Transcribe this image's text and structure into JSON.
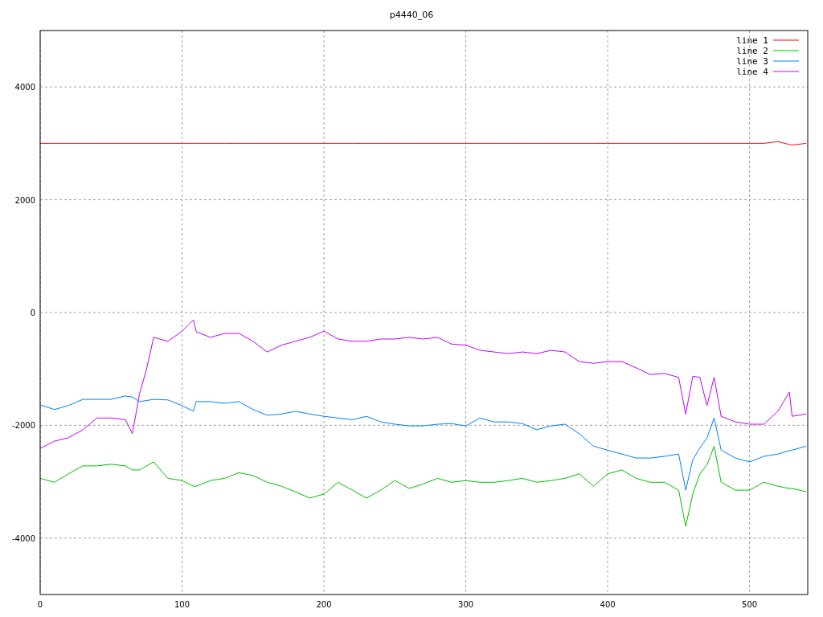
{
  "chart_data": {
    "type": "line",
    "title": "p4440_06",
    "x": [
      0,
      10,
      20,
      30,
      40,
      50,
      60,
      65,
      70,
      75,
      80,
      90,
      100,
      108,
      110,
      120,
      130,
      140,
      150,
      160,
      170,
      180,
      190,
      200,
      210,
      220,
      230,
      240,
      250,
      260,
      270,
      280,
      290,
      300,
      310,
      320,
      330,
      340,
      350,
      360,
      370,
      380,
      390,
      400,
      410,
      420,
      430,
      440,
      450,
      455,
      460,
      465,
      470,
      475,
      480,
      490,
      500,
      510,
      520,
      528,
      530,
      540
    ],
    "series": [
      {
        "name": "line 1",
        "color": "#ff0000",
        "values": [
          3000,
          3000,
          3000,
          3000,
          3000,
          3000,
          3000,
          3000,
          3000,
          3000,
          3000,
          3000,
          3000,
          3000,
          3000,
          3000,
          3000,
          3000,
          3000,
          3000,
          3000,
          3000,
          3000,
          3000,
          3000,
          3000,
          3000,
          3000,
          3000,
          3000,
          3000,
          3000,
          3000,
          3000,
          3000,
          3000,
          3000,
          3000,
          3000,
          3000,
          3000,
          3000,
          3000,
          3000,
          3000,
          3000,
          3000,
          3000,
          3000,
          3000,
          3000,
          3000,
          3000,
          3000,
          3000,
          3000,
          3000,
          3000,
          3030,
          2980,
          2970,
          3000
        ]
      },
      {
        "name": "line 2",
        "color": "#00c000",
        "values": [
          -2940,
          -3010,
          -2860,
          -2720,
          -2720,
          -2690,
          -2720,
          -2790,
          -2790,
          -2720,
          -2650,
          -2940,
          -2980,
          -3080,
          -3080,
          -2980,
          -2940,
          -2840,
          -2890,
          -3010,
          -3080,
          -3180,
          -3290,
          -3220,
          -3010,
          -3150,
          -3290,
          -3150,
          -2980,
          -3120,
          -3040,
          -2940,
          -3010,
          -2980,
          -3010,
          -3010,
          -2980,
          -2940,
          -3010,
          -2980,
          -2940,
          -2860,
          -3080,
          -2860,
          -2790,
          -2940,
          -3010,
          -3010,
          -3150,
          -3790,
          -3220,
          -2860,
          -2700,
          -2370,
          -3010,
          -3150,
          -3150,
          -3010,
          -3080,
          -3120,
          -3120,
          -3180
        ]
      },
      {
        "name": "line 3",
        "color": "#0080ff",
        "values": [
          -1640,
          -1720,
          -1650,
          -1540,
          -1540,
          -1540,
          -1480,
          -1500,
          -1580,
          -1560,
          -1540,
          -1550,
          -1650,
          -1750,
          -1580,
          -1580,
          -1610,
          -1580,
          -1720,
          -1820,
          -1800,
          -1750,
          -1800,
          -1840,
          -1870,
          -1900,
          -1840,
          -1940,
          -1980,
          -2010,
          -2010,
          -1980,
          -1970,
          -2010,
          -1870,
          -1940,
          -1940,
          -1970,
          -2080,
          -2010,
          -1980,
          -2150,
          -2370,
          -2440,
          -2510,
          -2580,
          -2580,
          -2550,
          -2510,
          -3150,
          -2610,
          -2400,
          -2220,
          -1870,
          -2440,
          -2580,
          -2650,
          -2550,
          -2510,
          -2450,
          -2440,
          -2370
        ]
      },
      {
        "name": "line 4",
        "color": "#c000ff",
        "values": [
          -2410,
          -2280,
          -2220,
          -2080,
          -1870,
          -1870,
          -1900,
          -2150,
          -1440,
          -1000,
          -440,
          -510,
          -330,
          -130,
          -340,
          -440,
          -370,
          -370,
          -510,
          -700,
          -580,
          -510,
          -440,
          -330,
          -470,
          -510,
          -510,
          -470,
          -470,
          -440,
          -470,
          -440,
          -560,
          -580,
          -670,
          -700,
          -730,
          -700,
          -730,
          -670,
          -700,
          -870,
          -900,
          -870,
          -870,
          -980,
          -1100,
          -1080,
          -1150,
          -1800,
          -1130,
          -1150,
          -1650,
          -1150,
          -1840,
          -1940,
          -1980,
          -1980,
          -1750,
          -1410,
          -1840,
          -1800
        ]
      }
    ],
    "xlim": [
      0,
      541
    ],
    "ylim": [
      -5000,
      5000
    ],
    "xticks": [
      0,
      100,
      200,
      300,
      400,
      500
    ],
    "yticks": [
      -4000,
      -2000,
      0,
      2000,
      4000
    ],
    "grid": true,
    "legend": true
  }
}
